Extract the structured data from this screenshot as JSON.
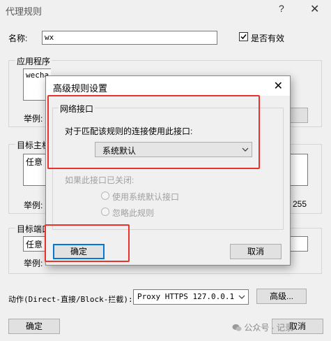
{
  "window": {
    "title": "代理规则",
    "help": "?",
    "close": "✕"
  },
  "name_label": "名称:",
  "name_value": "wx",
  "enabled_label": "是否有效",
  "apps_label": "应用程序",
  "apps_value": "wecha",
  "example_label_1": "举例:",
  "target_hosts_label": "目标主机",
  "target_hosts_value": "任意",
  "example_label_2": "举例:",
  "target_hosts_example_tail": "255",
  "target_ports_label": "目标端口",
  "target_ports_value": "任意",
  "example_label_3": "举例:",
  "action_label": "动作(Direct-直接/Block-拦截):",
  "action_value": "Proxy HTTPS 127.0.0.1",
  "advanced_button": "高级...",
  "ok_button": "确定",
  "cancel_button": "取消",
  "watermark": "公众号 · 记录",
  "dialog": {
    "title": "高级规则设置",
    "close": "✕",
    "group_label": "网络接口",
    "prompt": "对于匹配该规则的连接使用此接口:",
    "interface_value": "系统默认",
    "closed_label": "如果此接口已关闭:",
    "radio1": "使用系统默认接口",
    "radio2": "忽略此规则",
    "ok": "确定",
    "cancel": "取消"
  },
  "colors": {
    "highlight": "#e8322a",
    "focus": "#0078d7"
  }
}
